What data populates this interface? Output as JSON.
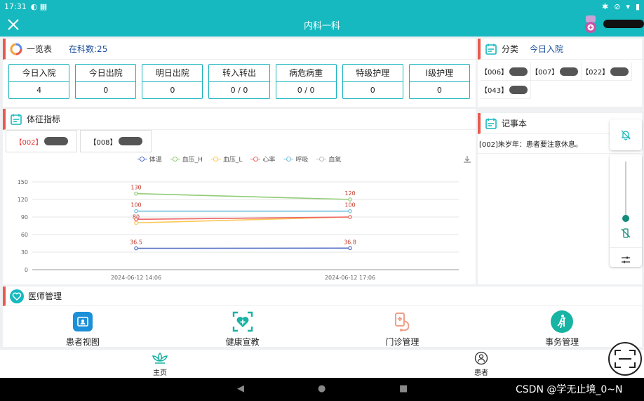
{
  "status_bar": {
    "time": "17:31"
  },
  "title_bar": {
    "title": "内科一科"
  },
  "overview": {
    "title": "一览表",
    "census": "在科数:25",
    "stats": [
      {
        "label": "今日入院",
        "value": "4"
      },
      {
        "label": "今日出院",
        "value": "0"
      },
      {
        "label": "明日出院",
        "value": "0"
      },
      {
        "label": "转入转出",
        "value": "0 / 0"
      },
      {
        "label": "病危病重",
        "value": "0 / 0"
      },
      {
        "label": "特级护理",
        "value": "0"
      },
      {
        "label": "I级护理",
        "value": "0"
      }
    ]
  },
  "vitals": {
    "title": "体征指标",
    "tabs": [
      {
        "code": "【002】"
      },
      {
        "code": "【008】"
      }
    ]
  },
  "chart_data": {
    "type": "line",
    "x": [
      "2024-06-12 14:06",
      "2024-06-12 17:06"
    ],
    "ylim": [
      0,
      150
    ],
    "yticks": [
      0,
      30,
      60,
      90,
      120,
      150
    ],
    "grid": true,
    "legend_position": "top",
    "series": [
      {
        "name": "体温",
        "color": "#5470c6",
        "values": [
          36.5,
          36.8
        ],
        "labels": [
          "36.5",
          "36.8"
        ]
      },
      {
        "name": "血压_H",
        "color": "#91cc75",
        "values": [
          130,
          120
        ],
        "labels": [
          "130",
          "120"
        ]
      },
      {
        "name": "血压_L",
        "color": "#fac858",
        "values": [
          80,
          90
        ],
        "labels": [
          "80",
          ""
        ]
      },
      {
        "name": "心率",
        "color": "#ee6666",
        "values": [
          86,
          90
        ],
        "labels": [
          "",
          ""
        ]
      },
      {
        "name": "呼吸",
        "color": "#73c0de",
        "values": [
          100,
          100
        ],
        "labels": [
          "100",
          "100"
        ]
      },
      {
        "name": "血氧",
        "color": "#bbbbbb",
        "values": [
          null,
          null
        ],
        "labels": [
          "",
          ""
        ]
      }
    ]
  },
  "category": {
    "title": "分类",
    "selected": "今日入院",
    "beds": [
      "【006】",
      "【007】",
      "【022】",
      "【043】"
    ]
  },
  "notebook": {
    "title": "记事本",
    "entries": [
      "[002]朱岁年：患者要注意休息。"
    ]
  },
  "doctor": {
    "title": "医师管理",
    "items": [
      {
        "label": "患者视图",
        "icon": "patient-view-icon"
      },
      {
        "label": "健康宣教",
        "icon": "health-education-icon"
      },
      {
        "label": "门诊管理",
        "icon": "outpatient-icon"
      },
      {
        "label": "事务管理",
        "icon": "affairs-icon"
      }
    ]
  },
  "bottom_nav": {
    "home": "主页",
    "patient": "患者"
  },
  "watermark": "CSDN @学无止境_0~N",
  "colors": {
    "teal": "#16b9bf",
    "accent_red": "#e85a4f",
    "link_blue": "#1a4d99"
  }
}
